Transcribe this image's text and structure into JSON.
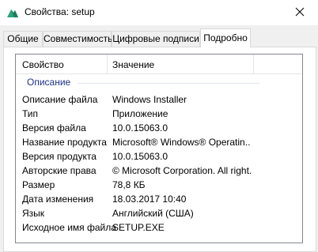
{
  "window": {
    "title": "Свойства: setup",
    "icon": "setup-package-icon",
    "close_icon": "close-icon"
  },
  "tabs": [
    {
      "label": "Общие",
      "active": false
    },
    {
      "label": "Совместимость",
      "active": false
    },
    {
      "label": "Цифровые подписи",
      "active": false
    },
    {
      "label": "Подробно",
      "active": true
    }
  ],
  "details": {
    "columns": {
      "property": "Свойство",
      "value": "Значение"
    },
    "group": "Описание",
    "rows": [
      {
        "key": "Описание файла",
        "value": "Windows Installer"
      },
      {
        "key": "Тип",
        "value": "Приложение"
      },
      {
        "key": "Версия файла",
        "value": "10.0.15063.0"
      },
      {
        "key": "Название продукта",
        "value": "Microsoft® Windows® Operatin..."
      },
      {
        "key": "Версия продукта",
        "value": "10.0.15063.0"
      },
      {
        "key": "Авторские права",
        "value": "© Microsoft Corporation. All right..."
      },
      {
        "key": "Размер",
        "value": "78,8 КБ"
      },
      {
        "key": "Дата изменения",
        "value": "18.03.2017 10:40"
      },
      {
        "key": "Язык",
        "value": "Английский (США)"
      },
      {
        "key": "Исходное имя файла",
        "value": "SETUP.EXE"
      }
    ]
  },
  "colors": {
    "group_header": "#1e3287",
    "list_border": "#828790"
  }
}
